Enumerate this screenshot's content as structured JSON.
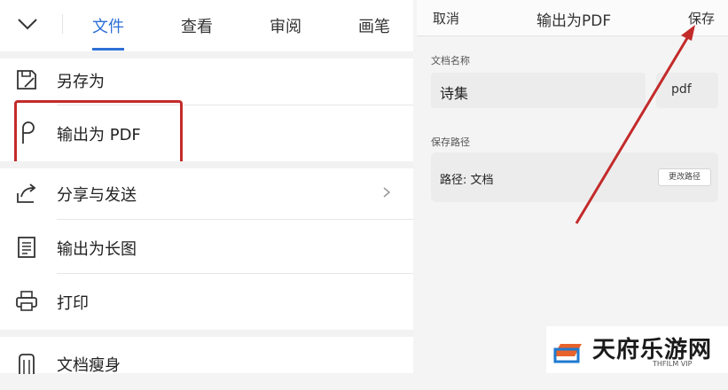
{
  "tabs": [
    {
      "label": "文件",
      "active": true
    },
    {
      "label": "查看",
      "active": false
    },
    {
      "label": "审阅",
      "active": false
    },
    {
      "label": "画笔",
      "active": false
    }
  ],
  "menu": [
    {
      "label": "另存为",
      "icon": "save-as-icon"
    },
    {
      "label": "输出为 PDF",
      "icon": "pdf-export-icon"
    },
    {
      "label": "分享与发送",
      "icon": "share-icon"
    },
    {
      "label": "输出为长图",
      "icon": "long-image-icon"
    },
    {
      "label": "打印",
      "icon": "printer-icon"
    },
    {
      "label": "文档瘦身",
      "icon": "slim-doc-icon"
    }
  ],
  "export_dialog": {
    "cancel": "取消",
    "title": "输出为PDF",
    "save": "保存",
    "doc_name_label": "文档名称",
    "doc_name_value": "诗集",
    "extension": "pdf",
    "save_path_label": "保存路径",
    "path_text": "路径: 文档",
    "change_path": "更改路径"
  },
  "watermark": {
    "name": "天府乐游网",
    "sub": "THFILM VIP"
  },
  "colors": {
    "accent": "#2d6fd6",
    "highlight": "#c32a2a",
    "arrow": "#c32a2a"
  }
}
